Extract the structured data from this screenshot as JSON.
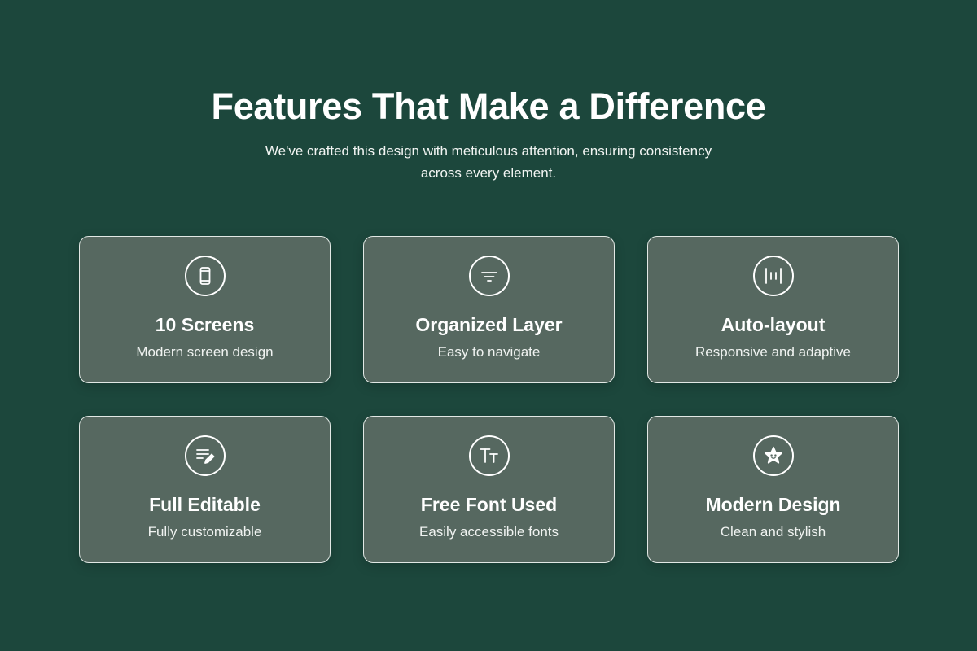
{
  "header": {
    "title": "Features That Make a Difference",
    "subtitle": "We've crafted this design with meticulous attention, ensuring consistency across every element."
  },
  "features": [
    {
      "title": "10 Screens",
      "description": "Modern screen design",
      "icon": "phone-icon"
    },
    {
      "title": "Organized Layer",
      "description": "Easy to navigate",
      "icon": "filter-icon"
    },
    {
      "title": "Auto-layout",
      "description": "Responsive and adaptive",
      "icon": "auto-layout-icon"
    },
    {
      "title": "Full Editable",
      "description": "Fully customizable",
      "icon": "edit-text-icon"
    },
    {
      "title": "Free Font Used",
      "description": "Easily accessible fonts",
      "icon": "font-size-icon"
    },
    {
      "title": "Modern Design",
      "description": "Clean and stylish",
      "icon": "star-face-icon"
    }
  ],
  "colors": {
    "background": "#1c473c",
    "card": "#566860",
    "text": "#ffffff"
  }
}
